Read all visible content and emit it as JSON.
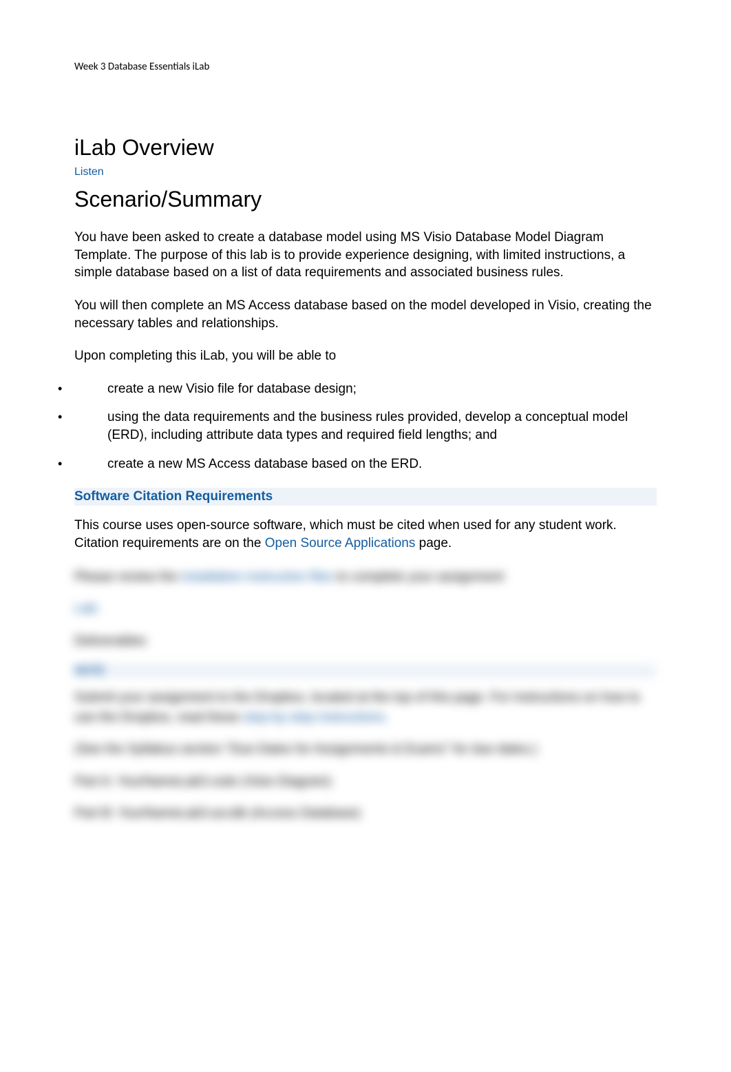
{
  "header": {
    "page_label": "Week 3 Database Essentials iLab"
  },
  "main": {
    "h_overview": "iLab Overview",
    "listen": "Listen",
    "h_scenario": "Scenario/Summary",
    "p1": "You have been asked to create a database model using MS Visio Database Model Diagram Template. The purpose of this lab is to provide experience designing, with limited instructions, a simple database based on a list of data requirements and associated business rules.",
    "p2": "You will then complete an MS Access database based on the model developed in Visio, creating the necessary tables and relationships.",
    "p3": "Upon completing this iLab, you will be able to",
    "bullets": [
      "create a new Visio file for database design;",
      "using the data requirements and the business rules provided, develop a conceptual model (ERD), including attribute data types and required field lengths; and",
      "create a new MS Access database based on the ERD."
    ],
    "citation_header": "Software Citation Requirements",
    "citation_body_a": "This course uses open-source software, which must be cited when used for any student work. Citation requirements are on the ",
    "citation_link": "Open Source Applications",
    "citation_body_b": " page."
  },
  "blurred": {
    "line1_a": "Please review the ",
    "line1_link": "installation instruction files",
    "line1_b": " to complete your assignment",
    "lab_link": "Lab:",
    "deliv": "Deliverables",
    "note": "NOTE",
    "line2_a": "Submit your assignment to the Dropbox, located at the top of this page. For instructions on how to use the Dropbox, read these ",
    "line2_link": "step-by-step instructions.",
    "line3": "(See the Syllabus section \"Due Dates for Assignments & Exams\" for due dates.)",
    "line4": "Part A: YourNameLab3.vsdx (Visio Diagram)",
    "line5": "Part B: YourNameLab3.accdb (Access Database)"
  }
}
